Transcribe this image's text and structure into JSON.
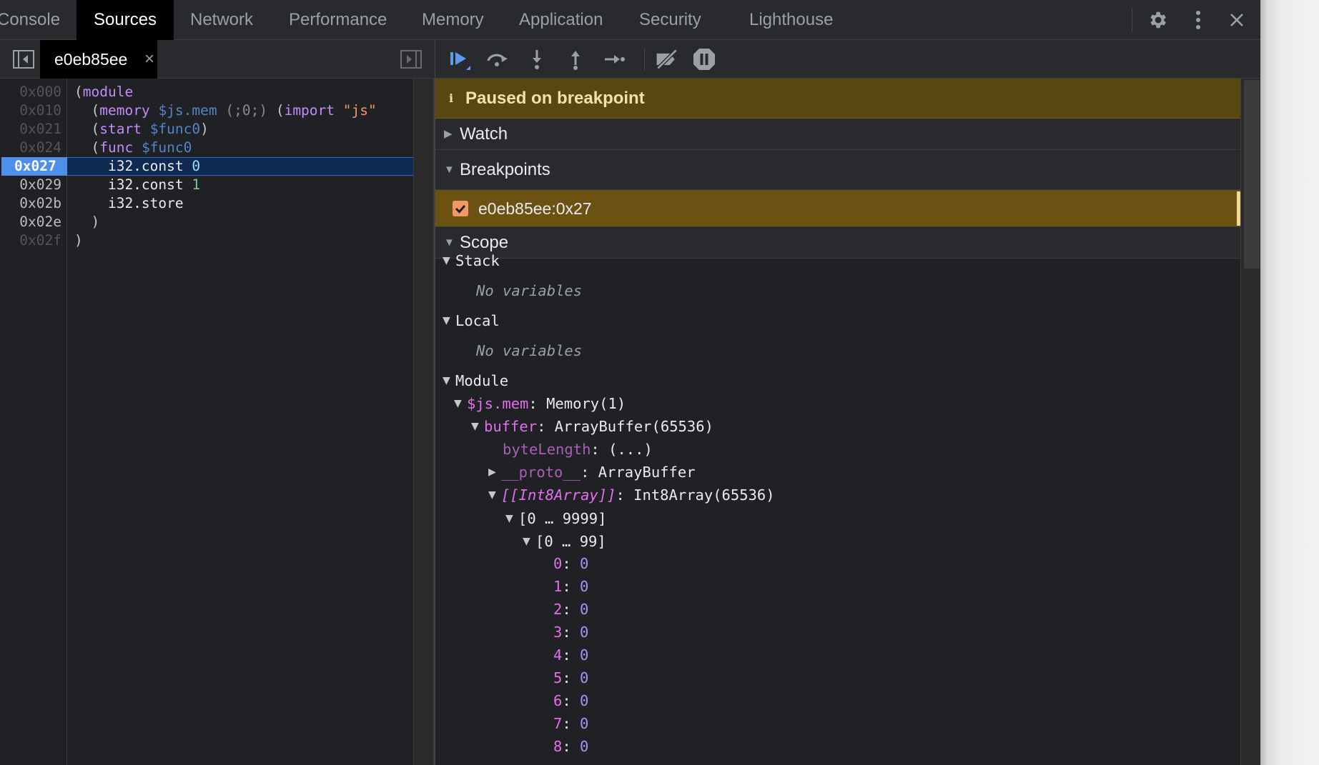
{
  "main_tabs": [
    "Console",
    "Sources",
    "Network",
    "Performance",
    "Memory",
    "Application",
    "Security",
    "Lighthouse"
  ],
  "active_main_tab": "Sources",
  "top_icons": [
    "gear-icon",
    "more-vertical-icon",
    "close-icon"
  ],
  "file_tab": {
    "label": "e0eb85ee",
    "close": "×"
  },
  "code_lines": [
    {
      "addr": "0x000",
      "text": "(module"
    },
    {
      "addr": "0x010",
      "text": "  (memory $js.mem (;0;) (import \"js\""
    },
    {
      "addr": "0x021",
      "text": "  (start $func0)"
    },
    {
      "addr": "0x024",
      "text": "  (func $func0"
    },
    {
      "addr": "0x027",
      "text": "    i32.const 0"
    },
    {
      "addr": "0x029",
      "text": "    i32.const 1"
    },
    {
      "addr": "0x02b",
      "text": "    i32.store"
    },
    {
      "addr": "0x02e",
      "text": "  )"
    },
    {
      "addr": "0x02f",
      "text": ")"
    }
  ],
  "current_line_addr": "0x027",
  "debugger_toolbar": [
    "resume-icon",
    "step-over-icon",
    "step-into-icon",
    "step-out-icon",
    "step-icon",
    "deactivate-breakpoints-icon",
    "pause-on-exceptions-icon"
  ],
  "paused_banner": {
    "icon": "i",
    "text": "Paused on breakpoint"
  },
  "sections": {
    "watch": "Watch",
    "breakpoints": "Breakpoints",
    "scope": "Scope"
  },
  "breakpoint": {
    "label": "e0eb85ee:0x27",
    "checked": true
  },
  "scope": {
    "stack": {
      "label": "Stack",
      "empty": "No variables"
    },
    "local": {
      "label": "Local",
      "empty": "No variables"
    },
    "module": {
      "label": "Module",
      "jsmem_name": "$js.mem",
      "jsmem_value": "Memory(1)",
      "buffer_name": "buffer",
      "buffer_value": "ArrayBuffer(65536)",
      "bytelength_name": "byteLength",
      "bytelength_value": "(...)",
      "proto_name": "__proto__",
      "proto_value": "ArrayBuffer",
      "int8_name": "[[Int8Array]]",
      "int8_value": "Int8Array(65536)",
      "range_outer": "[0 … 9999]",
      "range_inner": "[0 … 99]",
      "items": [
        {
          "index": "0",
          "value": "0"
        },
        {
          "index": "1",
          "value": "0"
        },
        {
          "index": "2",
          "value": "0"
        },
        {
          "index": "3",
          "value": "0"
        },
        {
          "index": "4",
          "value": "0"
        },
        {
          "index": "5",
          "value": "0"
        },
        {
          "index": "6",
          "value": "0"
        },
        {
          "index": "7",
          "value": "0"
        },
        {
          "index": "8",
          "value": "0"
        }
      ]
    }
  },
  "colors": {
    "accent_blue": "#5d9cec",
    "paused_banner_bg": "#574811",
    "breakpoint_row_bg": "#6b5212",
    "checkbox": "#f29766",
    "property_name": "#e36eec",
    "number_value": "#a592f7"
  }
}
